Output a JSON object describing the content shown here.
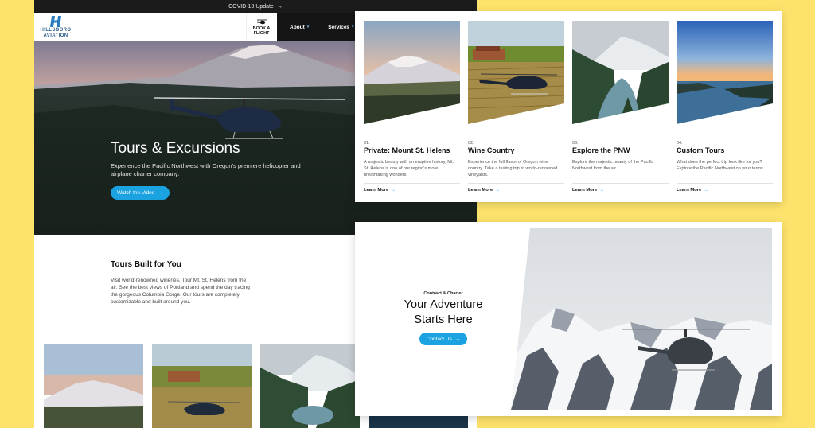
{
  "covid_banner": {
    "label": "COVID-19 Update",
    "arrow": "→"
  },
  "logo": {
    "line1": "HILLSBORO",
    "line2": "AVIATION"
  },
  "nav": {
    "book_label": "BOOK A FLIGHT",
    "items": [
      {
        "label": "About",
        "chevron": "▾"
      },
      {
        "label": "Services",
        "chevron": "▾"
      }
    ]
  },
  "hero": {
    "title": "Tours & Excursions",
    "subtitle": "Experience the Pacific Northwest with Oregon's premiere helicopter and airplane charter company.",
    "cta": "Watch the Video",
    "cta_arrow": "→"
  },
  "built": {
    "title": "Tours Built for You",
    "text": "Visit world-renowned wineries. Tour Mt. St. Helens from the air. See the best views of Portland and spend the day tracing the gorgeous Columbia Gorge. Our tours are completely customizable and built around you."
  },
  "tours": [
    {
      "num": "01.",
      "title": "Private: Mount St. Helens",
      "desc": "A majestic beauty with an eruptive history, Mt. St. Helens is one of our region's more breathtaking wonders.",
      "more": "Learn More",
      "arrow": "→"
    },
    {
      "num": "02.",
      "title": "Wine Country",
      "desc": "Experience the full flavor of Oregon wine country. Take a tasting trip to world-renowned vineyards.",
      "more": "Learn More",
      "arrow": "→"
    },
    {
      "num": "03.",
      "title": "Explore the PNW",
      "desc": "Explore the majestic beauty of the Pacific Northwest from the air.",
      "more": "Learn More",
      "arrow": "→"
    },
    {
      "num": "04.",
      "title": "Custom Tours",
      "desc": "What does the perfect trip look like for you? Explore the Pacific Northwest on your terms.",
      "more": "Learn More",
      "arrow": "→"
    }
  ],
  "adventure": {
    "kicker": "Contract & Charter",
    "title_line1": "Your Adventure",
    "title_line2": "Starts Here",
    "cta": "Contact Us",
    "cta_arrow": "→"
  },
  "colors": {
    "accent": "#1aa3e0",
    "background": "#fde36b",
    "nav_dark": "#151515"
  }
}
